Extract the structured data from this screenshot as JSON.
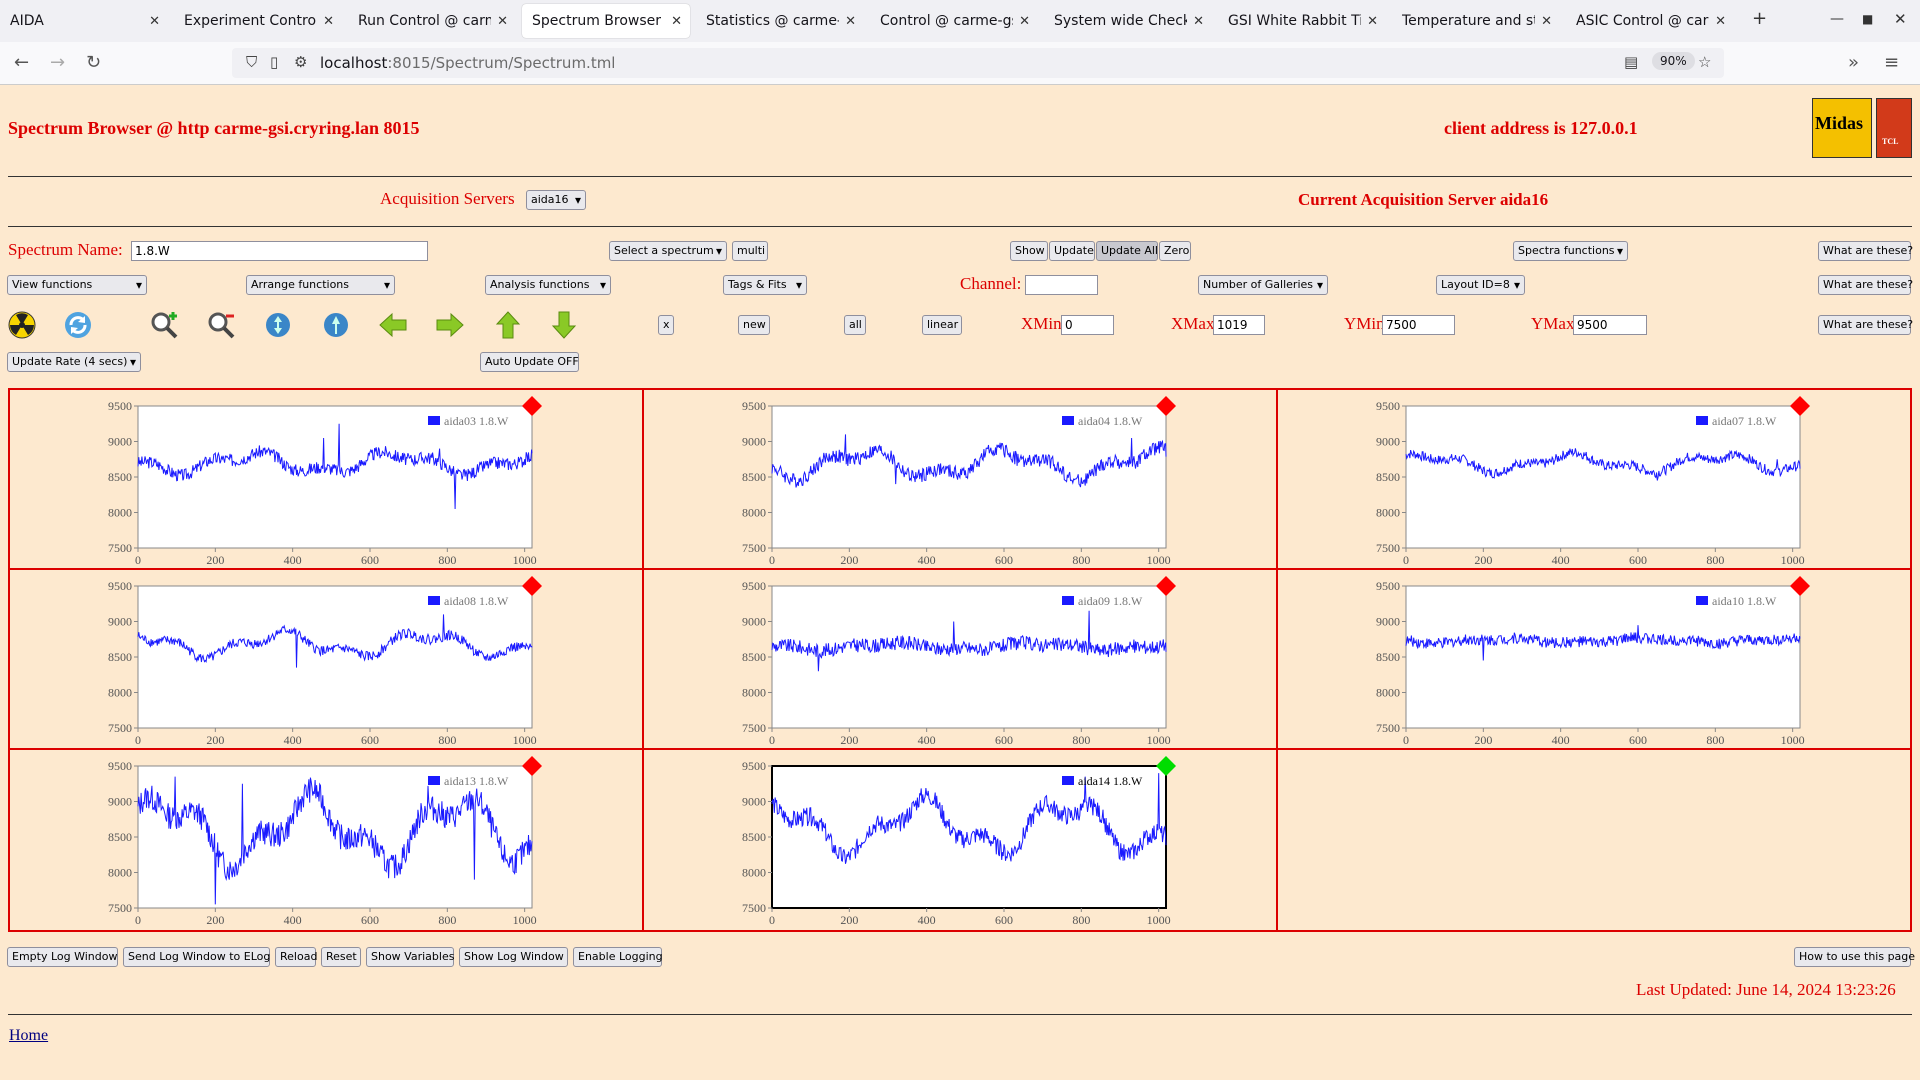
{
  "browser": {
    "tabs": [
      {
        "title": "AIDA",
        "active": false
      },
      {
        "title": "Experiment Control @ carme",
        "active": false
      },
      {
        "title": "Run Control @ carme-gsi",
        "active": false
      },
      {
        "title": "Spectrum Browser @ carme",
        "active": true
      },
      {
        "title": "Statistics @ carme-gsi",
        "active": false
      },
      {
        "title": "Control @ carme-gsi",
        "active": false
      },
      {
        "title": "System wide Checks @",
        "active": false
      },
      {
        "title": "GSI White Rabbit Tim",
        "active": false
      },
      {
        "title": "Temperature and stat",
        "active": false
      },
      {
        "title": "ASIC Control @ carme",
        "active": false
      }
    ],
    "url_host": "localhost",
    "url_path": ":8015/Spectrum/Spectrum.tml",
    "zoom": "90%"
  },
  "header": {
    "title": "Spectrum Browser @ http carme-gsi.cryring.lan 8015",
    "client": "client address is 127.0.0.1",
    "logo_text": "Midas",
    "logo_text2": "TCL"
  },
  "acq": {
    "servers_label": "Acquisition Servers",
    "server_value": "aida16",
    "current": "Current Acquisition Server aida16"
  },
  "controls": {
    "spectrum_name_label": "Spectrum Name:",
    "spectrum_name_value": "1.8.W",
    "select_spectrum": "Select a spectrum",
    "multi": "multi",
    "show": "Show",
    "update": "Update",
    "update_all": "Update All",
    "zero": "Zero",
    "spectra_functions": "Spectra functions",
    "what": "What are these?",
    "view_functions": "View functions",
    "arrange_functions": "Arrange functions",
    "analysis_functions": "Analysis functions",
    "tags_fits": "Tags & Fits",
    "channel_label": "Channel:",
    "channel_value": "",
    "num_galleries": "Number of Galleries",
    "layout": "Layout ID=8",
    "x": "x",
    "new": "new",
    "all": "all",
    "linear": "linear",
    "xmin_label": "XMin",
    "xmin": "0",
    "xmax_label": "XMax",
    "xmax": "1019",
    "ymin_label": "YMin",
    "ymin": "7500",
    "ymax_label": "YMax",
    "ymax": "9500",
    "update_rate": "Update Rate (4 secs)",
    "auto_update": "Auto Update OFF"
  },
  "icons": [
    "radiation-icon",
    "refresh-icon",
    "zoom-in-icon",
    "zoom-out-icon",
    "y-axis-icon",
    "x-axis-icon",
    "arrow-left-icon",
    "arrow-right-icon",
    "arrow-up-icon",
    "arrow-down-icon"
  ],
  "colors": {
    "accent": "#dc0000",
    "background": "#fde9cf",
    "trace": "#1a1aff",
    "marker_red": "#ff0000",
    "marker_green": "#00dd00"
  },
  "spectra": [
    {
      "label": "aida03 1.8.W",
      "selected": false,
      "seed": 3,
      "base": 8700,
      "amp": 120,
      "noise": 90,
      "spikes": [
        [
          520,
          9250
        ],
        [
          480,
          9050
        ],
        [
          820,
          8050
        ],
        [
          780,
          8900
        ]
      ]
    },
    {
      "label": "aida04 1.8.W",
      "selected": false,
      "seed": 4,
      "base": 8680,
      "amp": 160,
      "noise": 100,
      "spikes": [
        [
          190,
          9100
        ],
        [
          320,
          8400
        ],
        [
          930,
          9050
        ]
      ]
    },
    {
      "label": "aida07 1.8.W",
      "selected": false,
      "seed": 7,
      "base": 8700,
      "amp": 100,
      "noise": 70,
      "spikes": [
        [
          650,
          8450
        ],
        [
          960,
          8750
        ]
      ]
    },
    {
      "label": "aida08 1.8.W",
      "selected": false,
      "seed": 8,
      "base": 8680,
      "amp": 140,
      "noise": 70,
      "spikes": [
        [
          790,
          9100
        ],
        [
          410,
          8350
        ]
      ]
    },
    {
      "label": "aida09 1.8.W",
      "selected": false,
      "seed": 9,
      "base": 8650,
      "amp": 40,
      "noise": 100,
      "spikes": [
        [
          820,
          9150
        ],
        [
          470,
          8300
        ],
        [
          120,
          8950
        ],
        [
          120,
          8300
        ],
        [
          470,
          9000
        ]
      ]
    },
    {
      "label": "aida10 1.8.W",
      "selected": false,
      "seed": 10,
      "base": 8730,
      "amp": 30,
      "noise": 80,
      "spikes": [
        [
          200,
          9200
        ],
        [
          200,
          8450
        ],
        [
          600,
          8950
        ]
      ]
    },
    {
      "label": "aida13 1.8.W",
      "selected": false,
      "seed": 13,
      "base": 8600,
      "amp": 380,
      "noise": 180,
      "spikes": [
        [
          200,
          7550
        ],
        [
          95,
          9350
        ],
        [
          270,
          9250
        ],
        [
          750,
          9220
        ],
        [
          870,
          7900
        ]
      ]
    },
    {
      "label": "aida14 1.8.W",
      "selected": true,
      "seed": 14,
      "base": 8650,
      "amp": 300,
      "noise": 130,
      "spikes": [
        [
          810,
          9350
        ],
        [
          1000,
          9400
        ],
        [
          950,
          8300
        ]
      ]
    }
  ],
  "axis": {
    "xmin": 0,
    "xmax": 1019,
    "ymin": 7500,
    "ymax": 9500,
    "xticks": [
      "0",
      "200",
      "400",
      "600",
      "800",
      "1000"
    ],
    "yticks": [
      "9500",
      "9000",
      "8500",
      "8000",
      "7500"
    ]
  },
  "bottom": {
    "buttons": [
      "Empty Log Window",
      "Send Log Window to ELog",
      "Reload",
      "Reset",
      "Show Variables",
      "Show Log Window",
      "Enable Logging"
    ],
    "howto": "How to use this page",
    "last_updated": "Last Updated: June 14, 2024 13:23:26",
    "home": "Home"
  }
}
